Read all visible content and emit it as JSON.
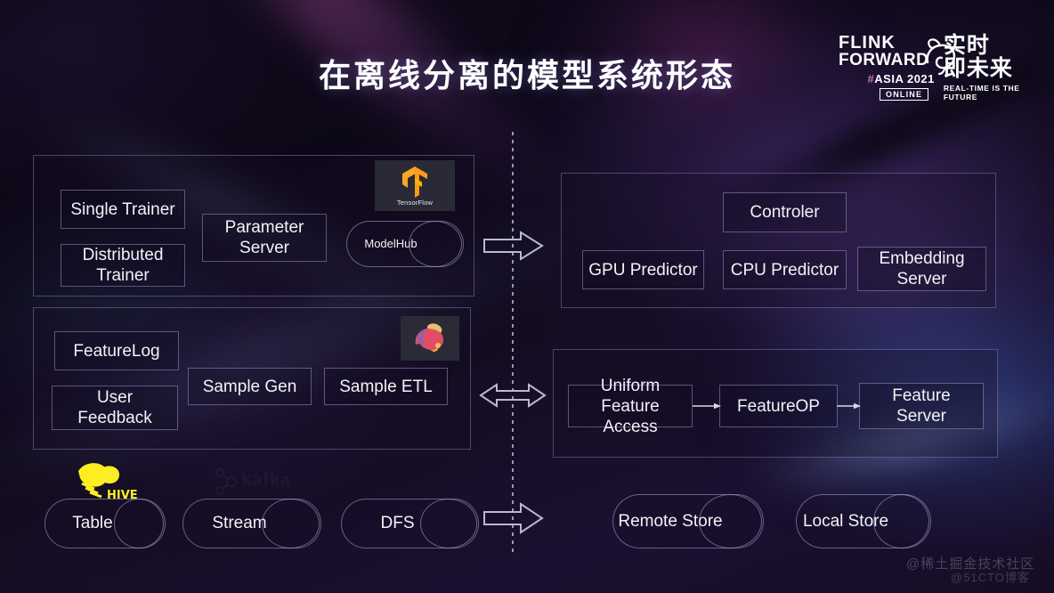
{
  "slide": {
    "title": "在离线分离的模型系统形态",
    "background_color": "#120a1c"
  },
  "logo": {
    "flink_line1": "FLINK",
    "flink_line2": "FORWARD",
    "hash": "#",
    "asia_year": "ASIA 2021",
    "online": "ONLINE",
    "chinese_title": "实时\n即未来",
    "chinese_line1": "实时",
    "chinese_line2": "即未来",
    "tagline": "REAL-TIME IS THE FUTURE"
  },
  "left_side": {
    "training_container": {
      "nodes": [
        {
          "id": "single-trainer",
          "label": "Single Trainer"
        },
        {
          "id": "distributed-trainer",
          "label": "Distributed Trainer"
        },
        {
          "id": "parameter-server",
          "label": "Parameter Server"
        }
      ],
      "cylinder": {
        "id": "modelhub",
        "label": "ModelHub"
      },
      "logo_tile": {
        "id": "tensorflow",
        "label": "TensorFlow"
      }
    },
    "sample_container": {
      "nodes": [
        {
          "id": "feature-log",
          "label": "FeatureLog"
        },
        {
          "id": "user-feedback",
          "label": "User Feedback"
        },
        {
          "id": "sample-gen",
          "label": "Sample Gen"
        },
        {
          "id": "sample-etl",
          "label": "Sample ETL"
        }
      ],
      "logo_tile": {
        "id": "apache-flink",
        "label": "Apache Flink"
      }
    },
    "storage_row": {
      "cylinders": [
        {
          "id": "table",
          "label": "Table",
          "mark": "hive"
        },
        {
          "id": "stream",
          "label": "Stream",
          "mark": "kafka"
        },
        {
          "id": "dfs",
          "label": "DFS",
          "mark": ""
        }
      ],
      "marks": {
        "hive": "HIVE",
        "kafka": "kafka"
      }
    }
  },
  "right_side": {
    "serving_container": {
      "nodes": [
        {
          "id": "controler",
          "label": "Controler"
        },
        {
          "id": "gpu-predictor",
          "label": "GPU Predictor"
        },
        {
          "id": "cpu-predictor",
          "label": "CPU Predictor"
        },
        {
          "id": "embedding-server",
          "label": "Embedding Server"
        }
      ]
    },
    "feature_container": {
      "nodes": [
        {
          "id": "uniform-feature-access",
          "label": "Uniform Feature Access"
        },
        {
          "id": "feature-op",
          "label": "FeatureOP"
        },
        {
          "id": "feature-server",
          "label": "Feature Server"
        }
      ]
    },
    "storage_row": {
      "cylinders": [
        {
          "id": "remote-store",
          "label": "Remote Store"
        },
        {
          "id": "local-store",
          "label": "Local Store"
        }
      ]
    }
  },
  "arrows": {
    "top": "right",
    "middle": "bidirectional",
    "bottom": "right"
  },
  "watermarks": {
    "primary": "@稀土掘金技术社区",
    "secondary": "@51CTO博客"
  },
  "colors": {
    "text": "#f2f2f7",
    "box_border": "rgba(160,160,210,0.50)",
    "accent_pink": "#c86fb0",
    "tensorflow_orange": "#ff8f1c",
    "hive_yellow": "#fdee21"
  }
}
